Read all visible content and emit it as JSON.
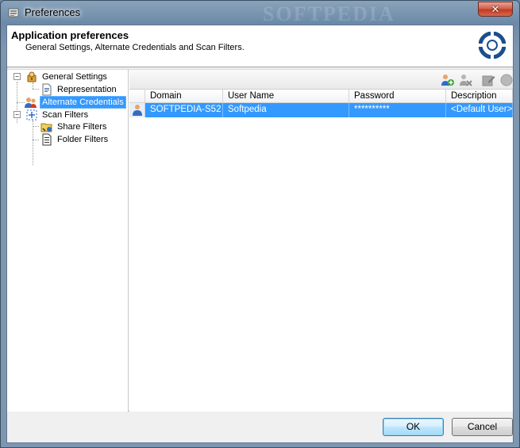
{
  "window": {
    "title": "Preferences",
    "watermark": "SOFTPEDIA",
    "close_label": "✕"
  },
  "header": {
    "title": "Application preferences",
    "description": "General Settings, Alternate Credentials and Scan Filters."
  },
  "tree": {
    "items": [
      {
        "label": "General Settings",
        "expander": "−"
      },
      {
        "label": "Representation"
      },
      {
        "label": "Alternate Credentials"
      },
      {
        "label": "Scan Filters",
        "expander": "−"
      },
      {
        "label": "Share Filters"
      },
      {
        "label": "Folder Filters"
      }
    ]
  },
  "toolbar": {
    "icons": [
      "add-user-icon",
      "remove-user-icon",
      "edit-icon",
      "circle-icon"
    ]
  },
  "grid": {
    "columns": [
      "Domain",
      "User Name",
      "Password",
      "Description"
    ],
    "rows": [
      {
        "domain": "SOFTPEDIA-S52",
        "user": "Softpedia",
        "password": "**********",
        "description": "<Default User>"
      }
    ]
  },
  "buttons": {
    "ok": "OK",
    "cancel": "Cancel"
  },
  "colors": {
    "selection": "#3399ff",
    "accent": "#1b4f8c"
  }
}
